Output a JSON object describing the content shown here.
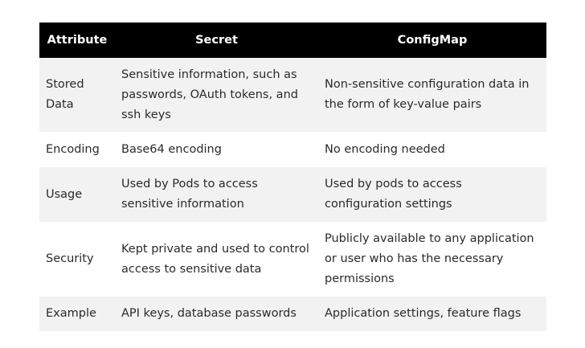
{
  "table": {
    "headers": [
      "Attribute",
      "Secret",
      "ConfigMap"
    ],
    "rows": [
      {
        "attribute": "Stored Data",
        "secret": "Sensitive information, such as passwords, OAuth tokens, and ssh keys",
        "configmap": "Non-sensitive configuration data in the form of key-value pairs"
      },
      {
        "attribute": "Encoding",
        "secret": "Base64 encoding",
        "configmap": "No encoding needed"
      },
      {
        "attribute": "Usage",
        "secret": "Used by Pods to access sensitive information",
        "configmap": "Used by pods to access configuration settings"
      },
      {
        "attribute": "Security",
        "secret": "Kept private and used to control access to sensitive data",
        "configmap": "Publicly available to any application or user who has the necessary permissions"
      },
      {
        "attribute": "Example",
        "secret": "API keys, database passwords",
        "configmap": "Application settings, feature flags"
      }
    ]
  },
  "colors": {
    "header_bg": "#000000",
    "header_text": "#ffffff",
    "row_alt_bg": "#f2f2f2",
    "row_bg": "#ffffff"
  }
}
